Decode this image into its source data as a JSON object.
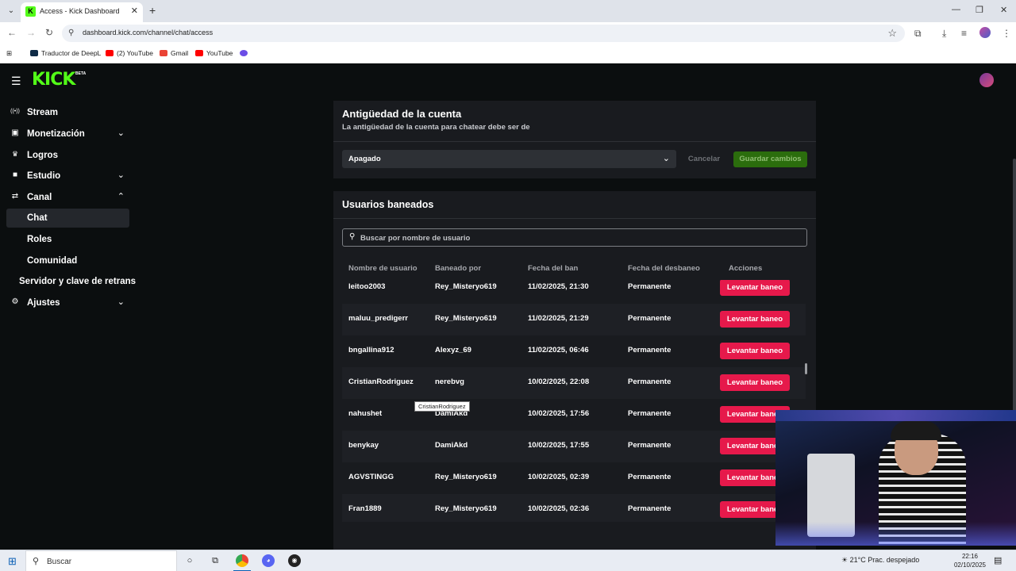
{
  "browser": {
    "tab_title": "Access - Kick Dashboard",
    "url": "dashboard.kick.com/channel/chat/access",
    "bookmarks": [
      {
        "label": "Traductor de DeepL",
        "color": "#0f2b46"
      },
      {
        "label": "(2) YouTube",
        "color": "#ff0000"
      },
      {
        "label": "Gmail",
        "color": "#ea4335"
      },
      {
        "label": "YouTube",
        "color": "#ff0000"
      }
    ]
  },
  "app": {
    "logo": "KICK",
    "logo_badge": "BETA"
  },
  "sidebar": {
    "items": [
      {
        "label": "Stream",
        "icon": "broadcast-icon",
        "glyph": "((•))",
        "chevron": ""
      },
      {
        "label": "Monetización",
        "icon": "chart-icon",
        "glyph": "▣",
        "chevron": "down"
      },
      {
        "label": "Logros",
        "icon": "trophy-icon",
        "glyph": "🏆",
        "chevron": ""
      },
      {
        "label": "Estudio",
        "icon": "studio-icon",
        "glyph": "■",
        "chevron": "down"
      },
      {
        "label": "Canal",
        "icon": "channel-icon",
        "glyph": "⇄",
        "chevron": "up"
      },
      {
        "label": "Chat",
        "icon": "",
        "glyph": "",
        "chevron": "",
        "active": true
      },
      {
        "label": "Roles",
        "icon": "",
        "glyph": "",
        "chevron": ""
      },
      {
        "label": "Comunidad",
        "icon": "",
        "glyph": "",
        "chevron": ""
      },
      {
        "label": "Servidor y clave de retrans",
        "icon": "",
        "glyph": "",
        "chevron": ""
      },
      {
        "label": "Ajustes",
        "icon": "gear-icon",
        "glyph": "⚙",
        "chevron": "down"
      }
    ]
  },
  "account_age": {
    "title": "Antigüedad de la cuenta",
    "subtitle": "La antigüedad de la cuenta para chatear debe ser de",
    "selected": "Apagado",
    "cancel_label": "Cancelar",
    "save_label": "Guardar cambios"
  },
  "banned": {
    "title": "Usuarios baneados",
    "search_placeholder": "Buscar por nombre de usuario",
    "columns": [
      "Nombre de usuario",
      "Baneado por",
      "Fecha del ban",
      "Fecha del desbaneo",
      "Acciones"
    ],
    "action_label": "Levantar baneo",
    "rows": [
      {
        "user": "leitoo2003",
        "by": "Rey_Misteryo619",
        "date": "11/02/2025, 21:30",
        "unban": "Permanente"
      },
      {
        "user": "maluu_predigerr",
        "by": "Rey_Misteryo619",
        "date": "11/02/2025, 21:29",
        "unban": "Permanente"
      },
      {
        "user": "bngallina912",
        "by": "Alexyz_69",
        "date": "11/02/2025, 06:46",
        "unban": "Permanente"
      },
      {
        "user": "CristianRodriguez",
        "by": "nerebvg",
        "date": "10/02/2025, 22:08",
        "unban": "Permanente"
      },
      {
        "user": "nahushet",
        "by": "DamiAkd",
        "date": "10/02/2025, 17:56",
        "unban": "Permanente"
      },
      {
        "user": "benykay",
        "by": "DamiAkd",
        "date": "10/02/2025, 17:55",
        "unban": "Permanente"
      },
      {
        "user": "AGVSTINGG",
        "by": "Rey_Misteryo619",
        "date": "10/02/2025, 02:39",
        "unban": "Permanente"
      },
      {
        "user": "Fran1889",
        "by": "Rey_Misteryo619",
        "date": "10/02/2025, 02:36",
        "unban": "Permanente"
      }
    ],
    "tooltip": "CristianRodriguez"
  },
  "taskbar": {
    "search_label": "Buscar",
    "weather": "21°C  Prac. despejado",
    "time": "22:16",
    "date": "02/10/2025"
  }
}
